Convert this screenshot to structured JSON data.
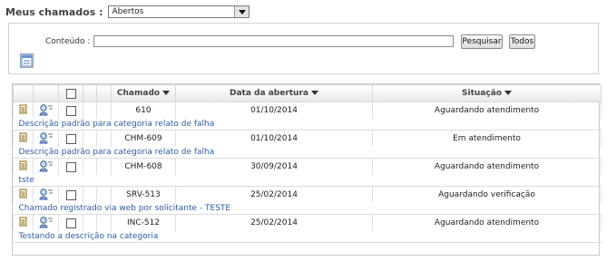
{
  "filter": {
    "label": "Meus chamados :",
    "selected": "Abertos"
  },
  "search": {
    "content_label": "Conteúdo :",
    "content_value": "",
    "search_button": "Pesquisar",
    "all_button": "Todos"
  },
  "table": {
    "headers": {
      "chamado": "Chamado",
      "data": "Data da abertura",
      "situacao": "Situação"
    },
    "rows": [
      {
        "id": "610",
        "date": "01/10/2014",
        "status": "Aguardando atendimento",
        "description": "Descrição padrão para categoria relato de falha"
      },
      {
        "id": "CHM-609",
        "date": "01/10/2014",
        "status": "Em atendimento",
        "description": "Descrição padrão para categoria relato de falha"
      },
      {
        "id": "CHM-608",
        "date": "30/09/2014",
        "status": "Aguardando atendimento",
        "description": "tste"
      },
      {
        "id": "SRV-513",
        "date": "25/02/2014",
        "status": "Aguardando verificação",
        "description": "Chamado registrado via web por solicitante - TESTE"
      },
      {
        "id": "INC-512",
        "date": "25/02/2014",
        "status": "Aguardando atendimento",
        "description": "Testando a descrição na categoria"
      }
    ]
  },
  "icons": {
    "filter_icon": "form-icon",
    "row_edit_icon": "document-edit-icon",
    "row_tech_icon": "technician-icon",
    "checkbox_icon": "checkbox"
  },
  "colors": {
    "link": "#2b5da8",
    "header_text": "#444444"
  }
}
